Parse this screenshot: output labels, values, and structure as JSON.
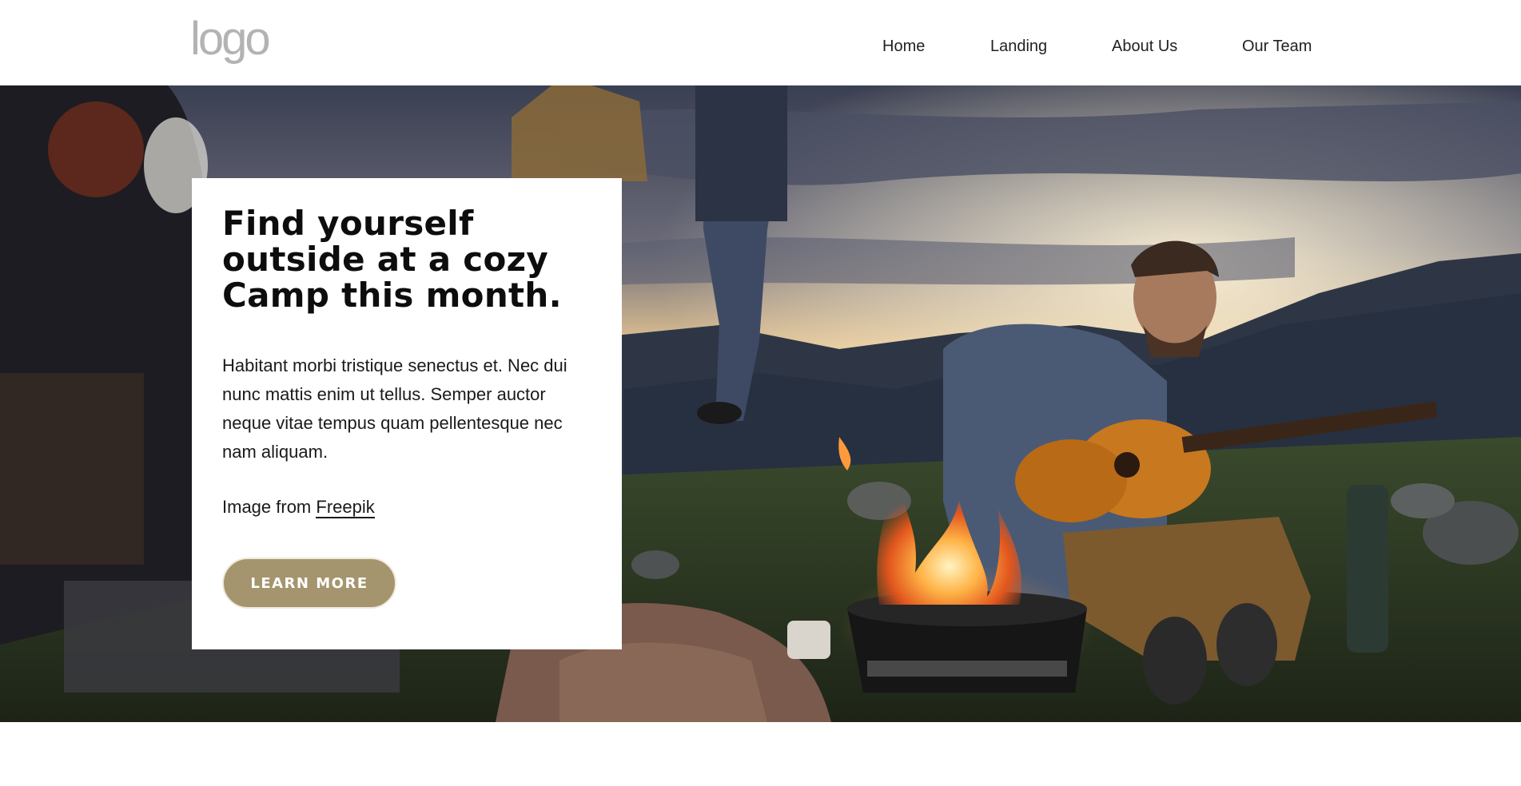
{
  "header": {
    "logo_text": "logo",
    "nav": [
      {
        "label": "Home"
      },
      {
        "label": "Landing"
      },
      {
        "label": "About Us"
      },
      {
        "label": "Our Team"
      }
    ]
  },
  "hero": {
    "image_icon": "campfire-guitar-photo",
    "card": {
      "title": "Find yourself outside at a cozy Camp this month.",
      "paragraph": "Habitant morbi tristique senectus et. Nec dui nunc mattis enim ut tellus. Semper auctor neque vitae tempus quam pellentesque nec nam aliquam.",
      "credit_prefix": "Image from ",
      "credit_link": "Freepik",
      "button_label": "LEARN MORE"
    }
  },
  "colors": {
    "button": "#a5956e",
    "logo": "#b3b3b3"
  }
}
